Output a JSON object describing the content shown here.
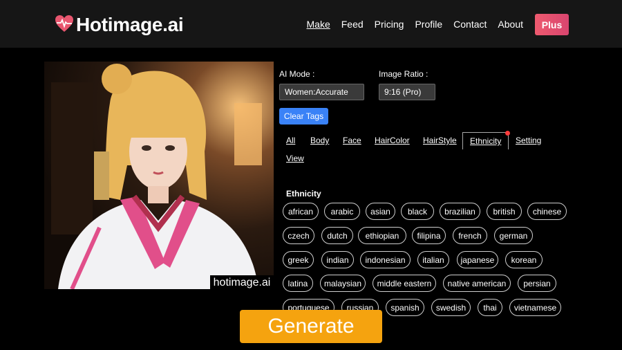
{
  "header": {
    "logo_text": "Hotimage.ai",
    "nav": [
      "Make",
      "Feed",
      "Pricing",
      "Profile",
      "Contact",
      "About"
    ],
    "plus_label": "Plus"
  },
  "preview": {
    "watermark": "hotimage.ai"
  },
  "controls": {
    "ai_mode_label": "AI Mode :",
    "ai_mode_value": "Women:Accurate",
    "ratio_label": "Image Ratio :",
    "ratio_value": "9:16 (Pro)",
    "clear_label": "Clear Tags"
  },
  "tabs": [
    "All",
    "Body",
    "Face",
    "HairColor",
    "HairStyle",
    "Ethnicity",
    "Setting",
    "View"
  ],
  "selected_tab": "Ethnicity",
  "section_title": "Ethnicity",
  "chips": [
    "african",
    "arabic",
    "asian",
    "black",
    "brazilian",
    "british",
    "chinese",
    "czech",
    "dutch",
    "ethiopian",
    "filipina",
    "french",
    "german",
    "greek",
    "indian",
    "indonesian",
    "italian",
    "japanese",
    "korean",
    "latina",
    "malaysian",
    "middle eastern",
    "native american",
    "persian",
    "portuguese",
    "russian",
    "spanish",
    "swedish",
    "thai",
    "vietnamese"
  ],
  "generate_label": "Generate",
  "colors": {
    "plus": "#e64f6f",
    "clear": "#3a82f7",
    "generate": "#f5a30f",
    "logo_heart": "#e8566f"
  }
}
